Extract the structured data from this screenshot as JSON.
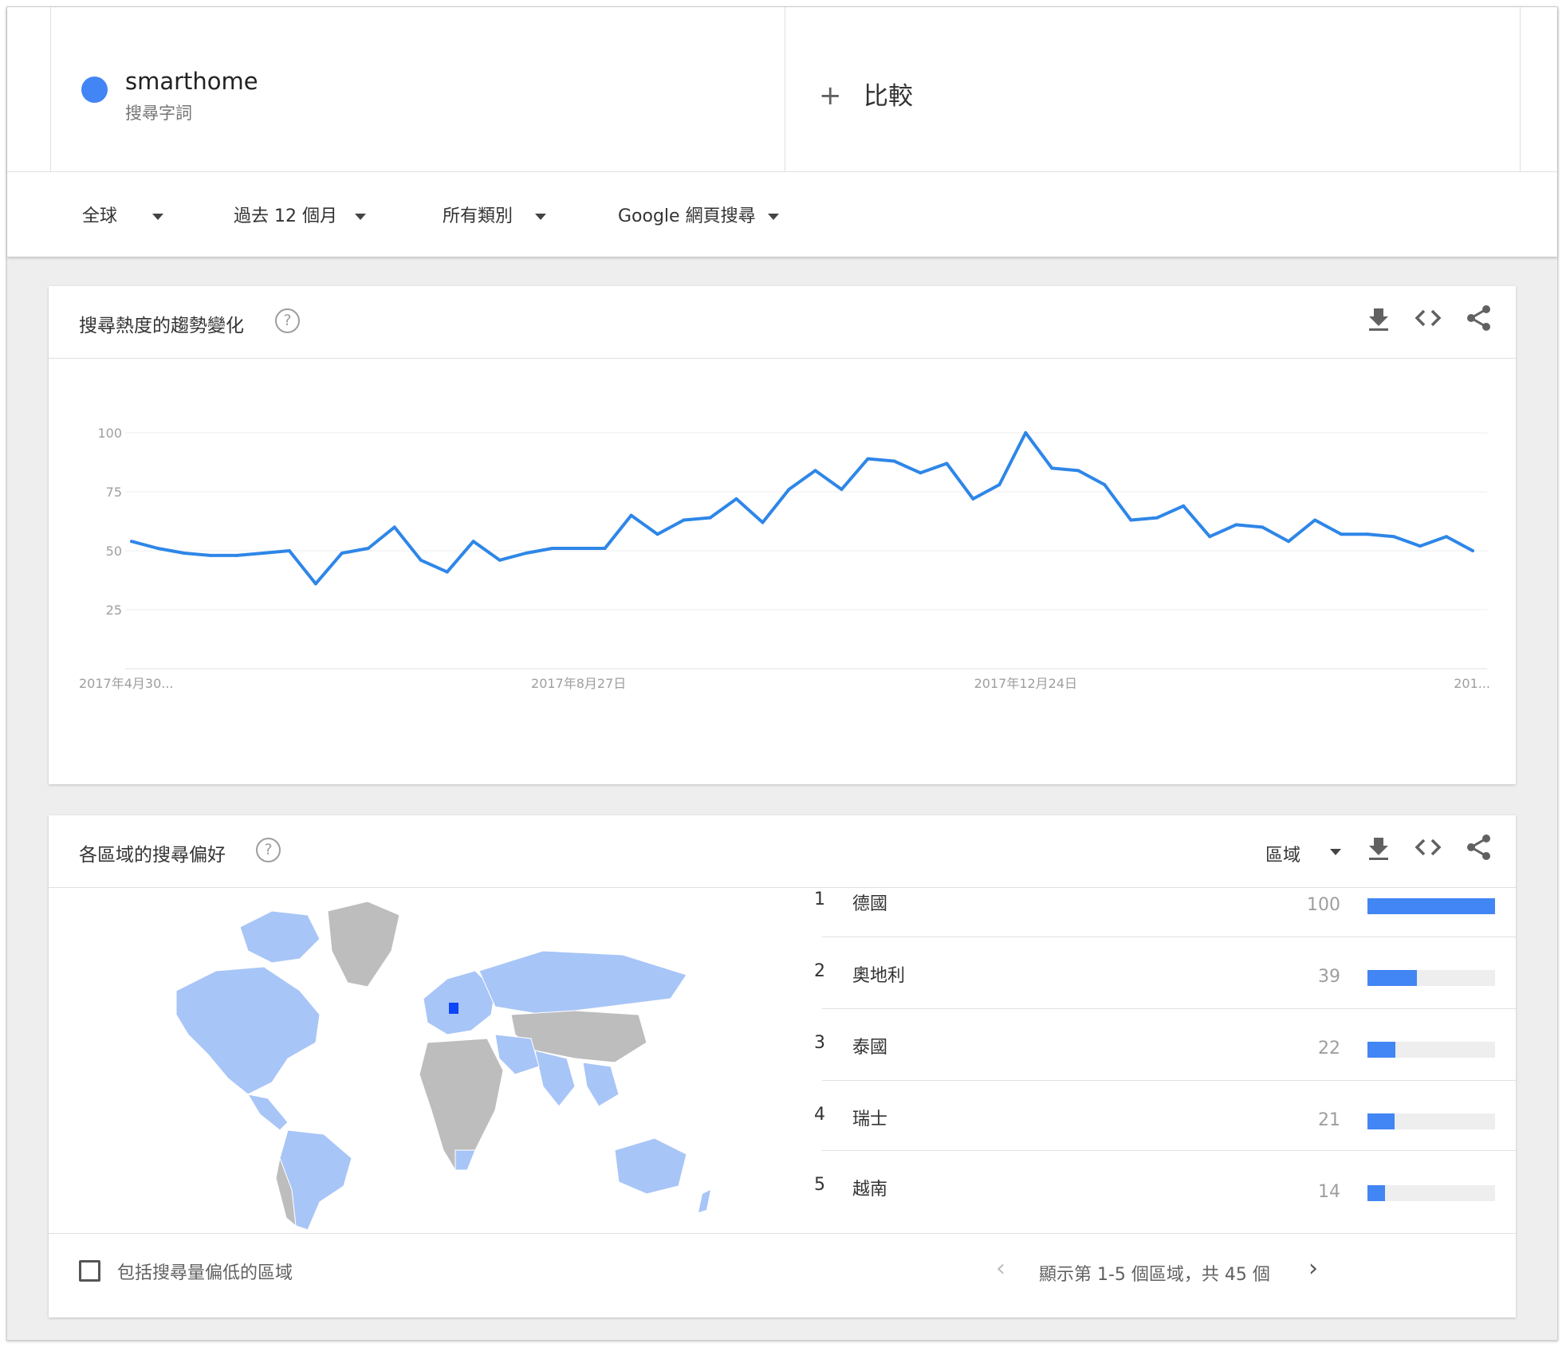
{
  "header": {
    "term": {
      "name": "smarthome",
      "type": "搜尋字詞",
      "color": "#4285f4"
    },
    "compare": {
      "plus": "+",
      "label": "比較"
    },
    "filters": [
      {
        "label": "全球"
      },
      {
        "label": "過去 12 個月"
      },
      {
        "label": "所有類別"
      },
      {
        "label": "Google 網頁搜尋"
      }
    ]
  },
  "interest_over_time": {
    "title": "搜尋熱度的趨勢變化",
    "help": "?",
    "tools": [
      "download-icon",
      "embed-code-icon",
      "share-icon"
    ]
  },
  "chart_data": {
    "type": "line",
    "yticks": [
      25,
      50,
      75,
      100
    ],
    "ylim": [
      0,
      100
    ],
    "x_tick_labels": [
      {
        "index": 0,
        "label": "2017年4月30..."
      },
      {
        "index": 17,
        "label": "2017年8月27日"
      },
      {
        "index": 34,
        "label": "2017年12月24日"
      },
      {
        "index": 51,
        "label": "201..."
      }
    ],
    "series": [
      {
        "color": "#2e86e8",
        "values": [
          54,
          51,
          49,
          48,
          48,
          49,
          50,
          36,
          49,
          51,
          60,
          46,
          41,
          54,
          46,
          49,
          51,
          51,
          51,
          65,
          57,
          63,
          64,
          72,
          62,
          76,
          84,
          76,
          89,
          88,
          83,
          87,
          72,
          78,
          100,
          85,
          84,
          78,
          63,
          64,
          69,
          56,
          61,
          60,
          54,
          63,
          57,
          57,
          56,
          52,
          56,
          50
        ]
      }
    ]
  },
  "interest_by_region": {
    "title": "各區域的搜尋偏好",
    "help": "?",
    "resolution": "區域",
    "tools": [
      "download-icon",
      "embed-code-icon",
      "share-icon"
    ],
    "map_colors": {
      "high": "#0d47f5",
      "medium": "#a8c5f7",
      "none": "#bdbdbd"
    },
    "rows": [
      {
        "rank": "1",
        "name": "德國",
        "value": 100
      },
      {
        "rank": "2",
        "name": "奧地利",
        "value": 39
      },
      {
        "rank": "3",
        "name": "泰國",
        "value": 22
      },
      {
        "rank": "4",
        "name": "瑞士",
        "value": 21
      },
      {
        "rank": "5",
        "name": "越南",
        "value": 14
      }
    ],
    "include_low_volume": "包括搜尋量偏低的區域",
    "pagination": "顯示第 1-5 個區域，共 45 個",
    "prev": "‹",
    "next": "›"
  }
}
